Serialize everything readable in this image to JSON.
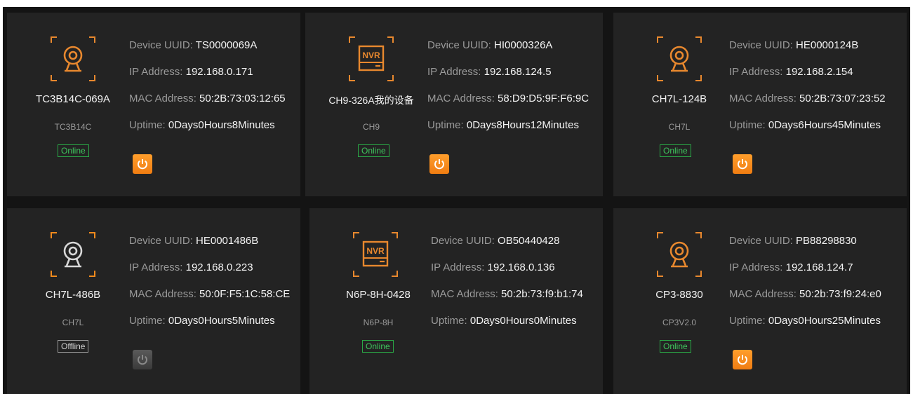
{
  "labels": {
    "uuid": "Device UUID: ",
    "ip": "IP Address: ",
    "mac": "MAC Address: ",
    "uptime": "Uptime: "
  },
  "colors": {
    "background": "#141414",
    "card": "#232323",
    "accent": "#f08a1c",
    "online": "#3ec45c",
    "offline": "#9a9a9a"
  },
  "devices": [
    {
      "name": "TC3B14C-069A",
      "model": "TC3B14C",
      "icon": "camera-icon",
      "icon_color": "#e8882e",
      "status": "Online",
      "uuid": "TS0000069A",
      "ip": "192.168.0.171",
      "mac": "50:2B:73:03:12:65",
      "uptime": "0Days0Hours8Minutes",
      "power": "on"
    },
    {
      "name": "CH9-326A我的设备",
      "model": "CH9",
      "icon": "nvr-icon",
      "icon_color": "#e8882e",
      "status": "Online",
      "uuid": "HI0000326A",
      "ip": "192.168.124.5",
      "mac": "58:D9:D5:9F:F6:9C",
      "uptime": "0Days8Hours12Minutes",
      "power": "on"
    },
    {
      "name": "CH7L-124B",
      "model": "CH7L",
      "icon": "camera-icon",
      "icon_color": "#e8882e",
      "status": "Online",
      "uuid": "HE0000124B",
      "ip": "192.168.2.154",
      "mac": "50:2B:73:07:23:52",
      "uptime": "0Days6Hours45Minutes",
      "power": "on"
    },
    {
      "name": "CH7L-486B",
      "model": "CH7L",
      "icon": "camera-icon",
      "icon_color": "#d8d8d8",
      "status": "Offline",
      "uuid": "HE0001486B",
      "ip": "192.168.0.223",
      "mac": "50:0F:F5:1C:58:CE",
      "uptime": "0Days0Hours5Minutes",
      "power": "off"
    },
    {
      "name": "N6P-8H-0428",
      "model": "N6P-8H",
      "icon": "nvr-icon",
      "icon_color": "#e8882e",
      "status": "Online",
      "uuid": "OB50440428",
      "ip": "192.168.0.136",
      "mac": "50:2b:73:f9:b1:74",
      "uptime": "0Days0Hours0Minutes",
      "power": "none"
    },
    {
      "name": "CP3-8830",
      "model": "CP3V2.0",
      "icon": "camera-icon",
      "icon_color": "#e8882e",
      "status": "Online",
      "uuid": "PB88298830",
      "ip": "192.168.124.7",
      "mac": "50:2b:73:f9:24:e0",
      "uptime": "0Days0Hours25Minutes",
      "power": "on"
    }
  ]
}
